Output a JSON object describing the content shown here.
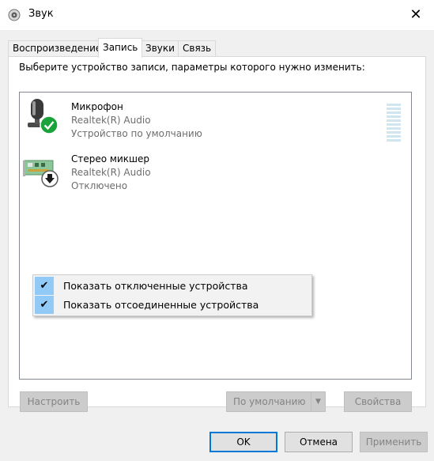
{
  "window": {
    "title": "Звук",
    "close_symbol": "✕"
  },
  "tabs": [
    {
      "label": "Воспроизведение",
      "active": false
    },
    {
      "label": "Запись",
      "active": true
    },
    {
      "label": "Звуки",
      "active": false
    },
    {
      "label": "Связь",
      "active": false
    }
  ],
  "instruction": "Выберите устройство записи, параметры которого нужно изменить:",
  "devices": [
    {
      "name": "Микрофон",
      "driver": "Realtek(R) Audio",
      "status": "Устройство по умолчанию",
      "icon": "microphone-icon",
      "badge": "default-check-icon"
    },
    {
      "name": "Стерео микшер",
      "driver": "Realtek(R) Audio",
      "status": "Отключено",
      "icon": "sound-card-icon",
      "badge": "disabled-arrow-icon"
    }
  ],
  "context_menu": [
    {
      "label": "Показать отключенные устройства",
      "checked": true
    },
    {
      "label": "Показать отсоединенные устройства",
      "checked": true
    }
  ],
  "buttons": {
    "configure": "Настроить",
    "set_default": "По умолчанию",
    "properties": "Свойства",
    "ok": "OK",
    "cancel": "Отмена",
    "apply": "Применить"
  },
  "colors": {
    "accent": "#0078d7",
    "menu_check": "#91c9f7",
    "status_green": "#1aa33a"
  }
}
